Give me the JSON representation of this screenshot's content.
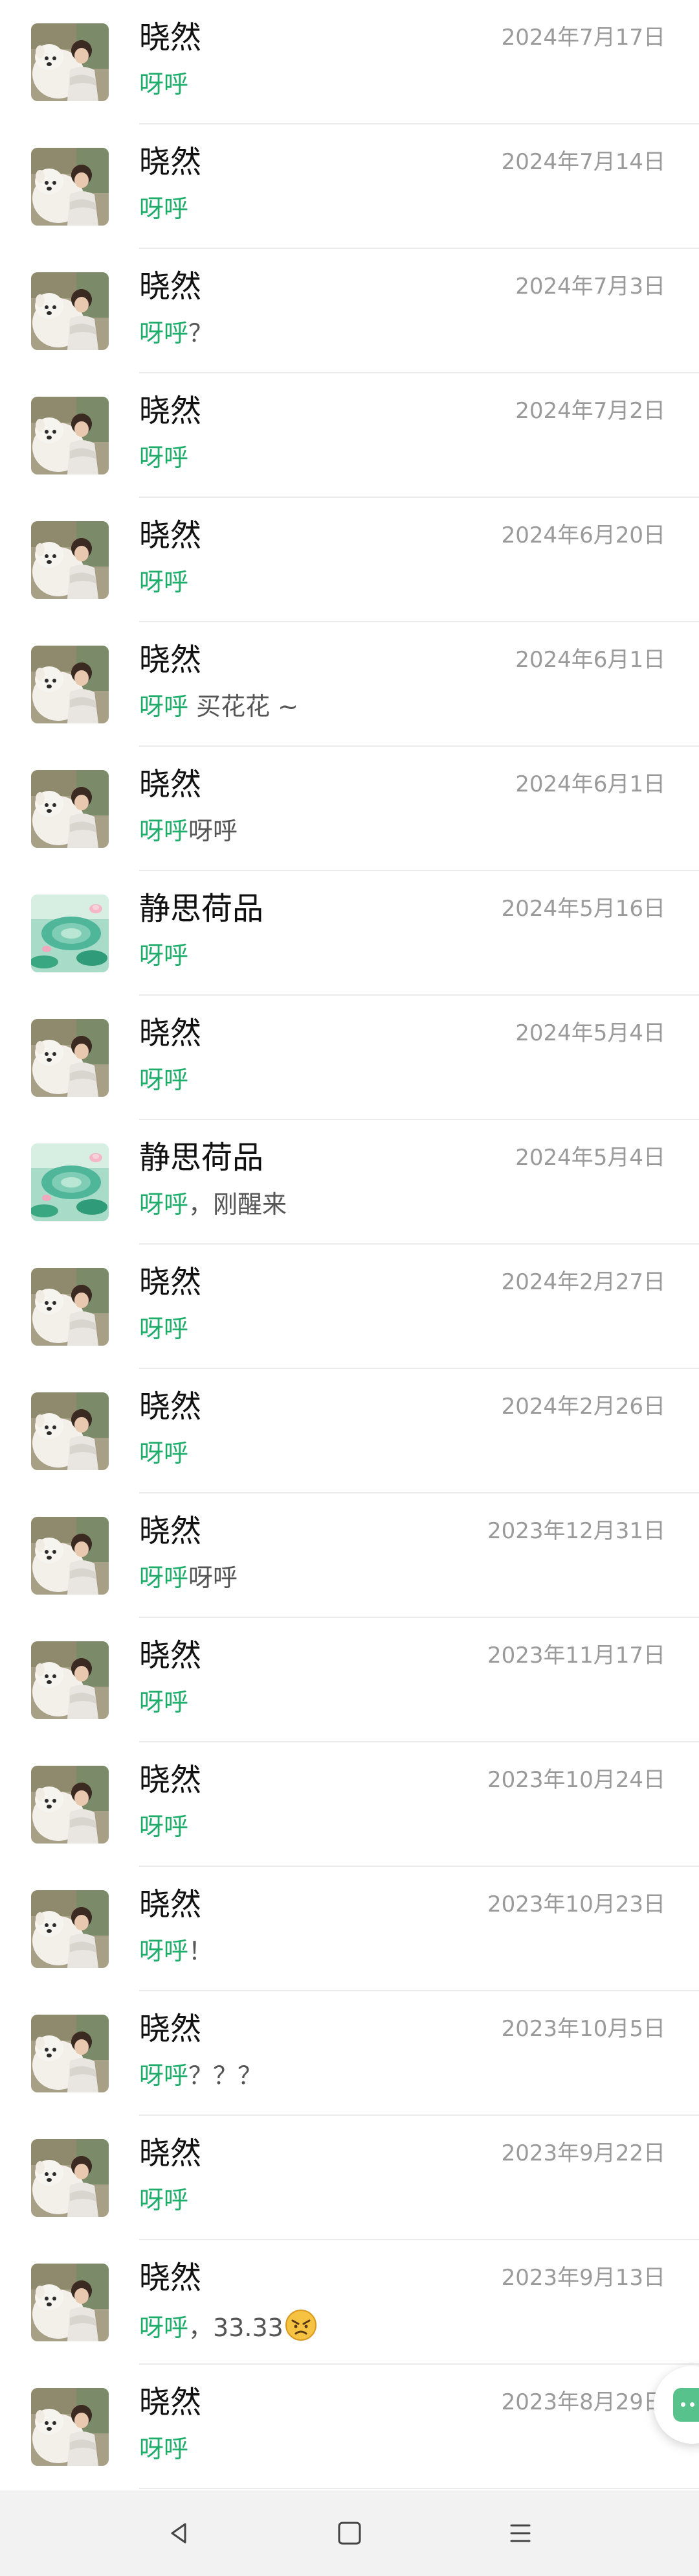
{
  "colors": {
    "keyword_green": "#1fad6b",
    "name_text": "#111111",
    "date_text": "#9a9a9a",
    "message_text": "#555555",
    "divider": "#ebebeb",
    "navbar_bg": "#f2f2f2"
  },
  "conversations": [
    {
      "name": "晓然",
      "date": "2024年7月17日",
      "keyword": "呀呼",
      "rest": "",
      "avatar": "dog-photo"
    },
    {
      "name": "晓然",
      "date": "2024年7月14日",
      "keyword": "呀呼",
      "rest": "",
      "avatar": "dog-photo"
    },
    {
      "name": "晓然",
      "date": "2024年7月3日",
      "keyword": "呀呼",
      "rest": "？",
      "avatar": "dog-photo"
    },
    {
      "name": "晓然",
      "date": "2024年7月2日",
      "keyword": "呀呼",
      "rest": "",
      "avatar": "dog-photo"
    },
    {
      "name": "晓然",
      "date": "2024年6月20日",
      "keyword": "呀呼",
      "rest": "",
      "avatar": "dog-photo"
    },
    {
      "name": "晓然",
      "date": "2024年6月1日",
      "keyword": "呀呼",
      "rest": " 买花花 ~",
      "avatar": "dog-photo"
    },
    {
      "name": "晓然",
      "date": "2024年6月1日",
      "keyword": "呀呼",
      "rest": "呀呼",
      "avatar": "dog-photo"
    },
    {
      "name": "静思荷品",
      "date": "2024年5月16日",
      "keyword": "呀呼",
      "rest": "",
      "avatar": "lotus-art"
    },
    {
      "name": "晓然",
      "date": "2024年5月4日",
      "keyword": "呀呼",
      "rest": "",
      "avatar": "dog-photo"
    },
    {
      "name": "静思荷品",
      "date": "2024年5月4日",
      "keyword": "呀呼",
      "rest": "，刚醒来",
      "avatar": "lotus-art"
    },
    {
      "name": "晓然",
      "date": "2024年2月27日",
      "keyword": "呀呼",
      "rest": "",
      "avatar": "dog-photo"
    },
    {
      "name": "晓然",
      "date": "2024年2月26日",
      "keyword": "呀呼",
      "rest": "",
      "avatar": "dog-photo"
    },
    {
      "name": "晓然",
      "date": "2023年12月31日",
      "keyword": "呀呼",
      "rest": "呀呼",
      "avatar": "dog-photo"
    },
    {
      "name": "晓然",
      "date": "2023年11月17日",
      "keyword": "呀呼",
      "rest": "",
      "avatar": "dog-photo"
    },
    {
      "name": "晓然",
      "date": "2023年10月24日",
      "keyword": "呀呼",
      "rest": "",
      "avatar": "dog-photo"
    },
    {
      "name": "晓然",
      "date": "2023年10月23日",
      "keyword": "呀呼",
      "rest": "！",
      "avatar": "dog-photo"
    },
    {
      "name": "晓然",
      "date": "2023年10月5日",
      "keyword": "呀呼",
      "rest": "？？？",
      "avatar": "dog-photo"
    },
    {
      "name": "晓然",
      "date": "2023年9月22日",
      "keyword": "呀呼",
      "rest": "",
      "avatar": "dog-photo"
    },
    {
      "name": "晓然",
      "date": "2023年9月13日",
      "keyword": "呀呼",
      "rest": "，33.33",
      "emoji": "angry-face-emoji",
      "avatar": "dog-photo"
    },
    {
      "name": "晓然",
      "date": "2023年8月29日",
      "keyword": "呀呼",
      "rest": "",
      "avatar": "dog-photo"
    }
  ],
  "floating_button": {
    "icon": "chat-bubble-icon"
  },
  "navbar": {
    "back_icon": "triangle-back-icon",
    "home_icon": "square-home-icon",
    "menu_icon": "three-lines-menu-icon"
  }
}
